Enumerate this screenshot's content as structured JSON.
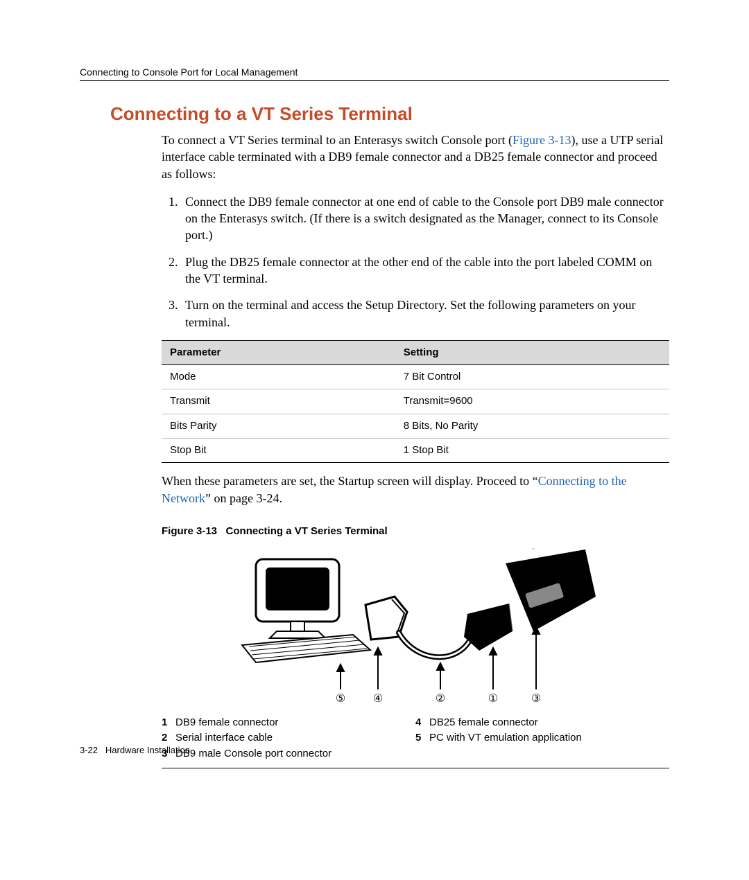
{
  "header": {
    "running": "Connecting to Console Port for Local Management"
  },
  "title": "Connecting to a VT Series Terminal",
  "intro": {
    "pre": "To connect a VT Series terminal to an Enterasys switch Console port (",
    "figref": "Figure 3-13",
    "post": "), use a UTP serial interface cable terminated with a DB9 female connector and a DB25 female connector and proceed as follows:"
  },
  "steps": [
    "Connect the DB9 female connector at one end of cable to the Console port DB9 male connector on the Enterasys switch. (If there is a switch designated as the Manager, connect to its Console port.)",
    "Plug the DB25 female connector at the other end of the cable into the port labeled COMM on the VT terminal.",
    "Turn on the terminal and access the Setup Directory. Set the following parameters on your terminal."
  ],
  "table": {
    "headers": [
      "Parameter",
      "Setting"
    ],
    "rows": [
      [
        "Mode",
        "7 Bit Control"
      ],
      [
        "Transmit",
        "Transmit=9600"
      ],
      [
        "Bits Parity",
        "8 Bits, No Parity"
      ],
      [
        "Stop Bit",
        "1 Stop Bit"
      ]
    ]
  },
  "after_table": {
    "pre": "When these parameters are set, the Startup screen will display. Proceed to “",
    "link": "Connecting to the Network",
    "post": "” on page 3-24."
  },
  "figure": {
    "label": "Figure 3-13",
    "title": "Connecting a VT Series Terminal",
    "callouts": {
      "c5": "⑤",
      "c4": "④",
      "c2": "②",
      "c1": "①",
      "c3": "③"
    }
  },
  "legend": {
    "left": [
      {
        "n": "1",
        "t": "DB9 female connector"
      },
      {
        "n": "2",
        "t": "Serial interface cable"
      },
      {
        "n": "3",
        "t": "DB9 male Console port connector"
      }
    ],
    "right": [
      {
        "n": "4",
        "t": "DB25 female connector"
      },
      {
        "n": "5",
        "t": "PC with VT emulation application"
      }
    ]
  },
  "footer": {
    "page": "3-22",
    "chapter": "Hardware Installation"
  }
}
